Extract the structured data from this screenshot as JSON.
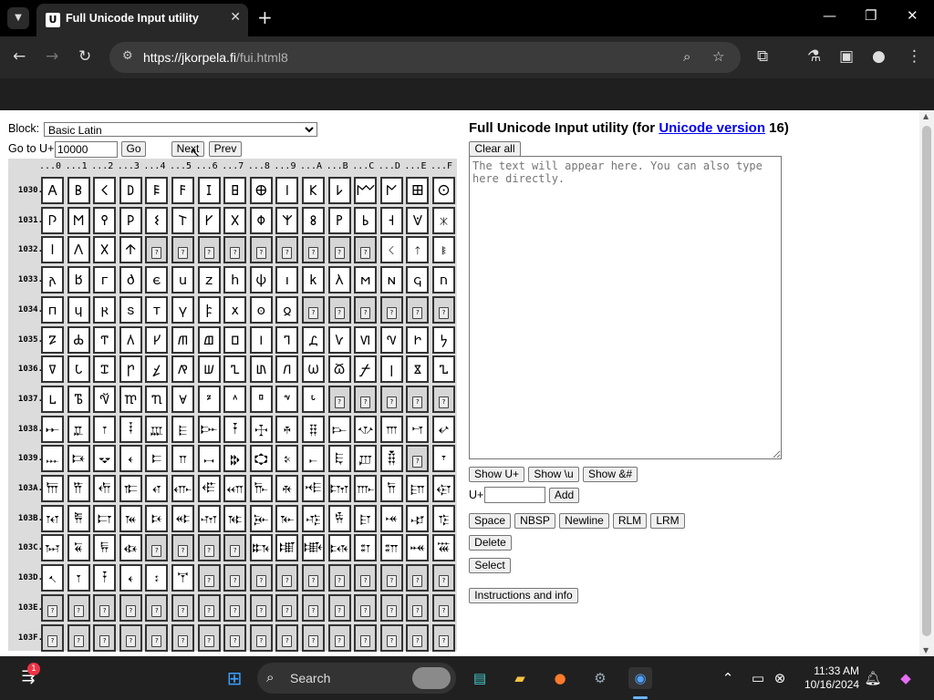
{
  "browser": {
    "tab_title": "Full Unicode Input utility",
    "favicon_letter": "U",
    "url_host": "https://jkorpela.fi",
    "url_path": "/fui.html8"
  },
  "page": {
    "block_label": "Block:",
    "block_selected": "Basic Latin",
    "goto_label": "Go to U+",
    "goto_value": "10000",
    "go_label": "Go",
    "next_label": "Next",
    "prev_label": "Prev",
    "title_prefix": "Full Unicode Input utility (for ",
    "title_link": "Unicode version",
    "title_suffix": " 16)",
    "clear_label": "Clear all",
    "textarea_placeholder": "The text will appear here. You can also type here directly.",
    "show_u_label": "Show U+",
    "show_backslash_u_label": "Show \\u",
    "show_entity_label": "Show &#",
    "uplus_label": "U+",
    "add_label": "Add",
    "space_label": "Space",
    "nbsp_label": "NBSP",
    "newline_label": "Newline",
    "rlm_label": "RLM",
    "lrm_label": "LRM",
    "delete_label": "Delete",
    "select_label": "Select",
    "instructions_label": "Instructions and info"
  },
  "grid": {
    "columns": [
      "...0",
      "...1",
      "...2",
      "...3",
      "...4",
      "...5",
      "...6",
      "...7",
      "...8",
      "...9",
      "...A",
      "...B",
      "...C",
      "...D",
      "...E",
      "...F"
    ],
    "rows": [
      {
        "label": "1030.",
        "cells": [
          "𐌀",
          "𐌁",
          "𐌂",
          "𐌃",
          "𐌄",
          "𐌅",
          "𐌆",
          "𐌇",
          "𐌈",
          "𐌉",
          "𐌊",
          "𐌋",
          "𐌌",
          "𐌍",
          "𐌎",
          "𐌏"
        ]
      },
      {
        "label": "1031.",
        "cells": [
          "𐌐",
          "𐌑",
          "𐌒",
          "𐌓",
          "𐌔",
          "𐌕",
          "𐌖",
          "𐌗",
          "𐌘",
          "𐌙",
          "𐌚",
          "𐌛",
          "𐌜",
          "𐌝",
          "𐌞",
          "𐌟"
        ]
      },
      {
        "label": "1032.",
        "cells": [
          "𐌠",
          "𐌡",
          "𐌢",
          "𐌣",
          "",
          "",
          "",
          "",
          "",
          "",
          "",
          "",
          "",
          "𐌭",
          "𐌮",
          "𐌯"
        ]
      },
      {
        "label": "1033.",
        "cells": [
          "𐌰",
          "𐌱",
          "𐌲",
          "𐌳",
          "𐌴",
          "𐌵",
          "𐌶",
          "𐌷",
          "𐌸",
          "𐌹",
          "𐌺",
          "𐌻",
          "𐌼",
          "𐌽",
          "𐌾",
          "𐌿"
        ]
      },
      {
        "label": "1034.",
        "cells": [
          "𐍀",
          "𐍁",
          "𐍂",
          "𐍃",
          "𐍄",
          "𐍅",
          "𐍆",
          "𐍇",
          "𐍈",
          "𐍉",
          "",
          "",
          "",
          "",
          "",
          ""
        ]
      },
      {
        "label": "1035.",
        "cells": [
          "𐍐",
          "𐍑",
          "𐍒",
          "𐍓",
          "𐍔",
          "𐍕",
          "𐍖",
          "𐍗",
          "𐍘",
          "𐍙",
          "𐍚",
          "𐍛",
          "𐍜",
          "𐍝",
          "𐍞",
          "𐍟"
        ]
      },
      {
        "label": "1036.",
        "cells": [
          "𐍠",
          "𐍡",
          "𐍢",
          "𐍣",
          "𐍤",
          "𐍥",
          "𐍦",
          "𐍧",
          "𐍨",
          "𐍩",
          "𐍪",
          "𐍫",
          "𐍬",
          "𐍭",
          "𐍮",
          "𐍯"
        ]
      },
      {
        "label": "1037.",
        "cells": [
          "𐍰",
          "𐍱",
          "𐍲",
          "𐍳",
          "𐍴",
          "𐍵",
          "𐍶",
          "𐍷",
          "𐍸",
          "𐍹",
          "𐍺",
          "",
          "",
          "",
          "",
          ""
        ]
      },
      {
        "label": "1038.",
        "cells": [
          "𐎀",
          "𐎁",
          "𐎂",
          "𐎃",
          "𐎄",
          "𐎅",
          "𐎆",
          "𐎇",
          "𐎈",
          "𐎉",
          "𐎊",
          "𐎋",
          "𐎌",
          "𐎍",
          "𐎎",
          "𐎏"
        ]
      },
      {
        "label": "1039.",
        "cells": [
          "𐎐",
          "𐎑",
          "𐎒",
          "𐎓",
          "𐎔",
          "𐎕",
          "𐎖",
          "𐎗",
          "𐎘",
          "𐎙",
          "𐎚",
          "𐎛",
          "𐎜",
          "𐎝",
          "",
          "𐎟"
        ]
      },
      {
        "label": "103A.",
        "cells": [
          "𐎠",
          "𐎡",
          "𐎢",
          "𐎣",
          "𐎤",
          "𐎥",
          "𐎦",
          "𐎧",
          "𐎨",
          "𐎩",
          "𐎪",
          "𐎫",
          "𐎬",
          "𐎭",
          "𐎮",
          "𐎯"
        ]
      },
      {
        "label": "103B.",
        "cells": [
          "𐎰",
          "𐎱",
          "𐎲",
          "𐎳",
          "𐎴",
          "𐎵",
          "𐎶",
          "𐎷",
          "𐎸",
          "𐎹",
          "𐎺",
          "𐎻",
          "𐎼",
          "𐎽",
          "𐎾",
          "𐎿"
        ]
      },
      {
        "label": "103C.",
        "cells": [
          "𐏀",
          "𐏁",
          "𐏂",
          "𐏃",
          "",
          "",
          "",
          "",
          "𐏈",
          "𐏉",
          "𐏊",
          "𐏋",
          "𐏌",
          "𐏍",
          "𐏎",
          "𐏏"
        ]
      },
      {
        "label": "103D.",
        "cells": [
          "𐏐",
          "𐏑",
          "𐏒",
          "𐏓",
          "𐏔",
          "𐏕",
          "",
          "",
          "",
          "",
          "",
          "",
          "",
          "",
          "",
          ""
        ]
      },
      {
        "label": "103E.",
        "cells": [
          "",
          "",
          "",
          "",
          "",
          "",
          "",
          "",
          "",
          "",
          "",
          "",
          "",
          "",
          "",
          ""
        ]
      },
      {
        "label": "103F.",
        "cells": [
          "",
          "",
          "",
          "",
          "",
          "",
          "",
          "",
          "",
          "",
          "",
          "",
          "",
          "",
          "",
          ""
        ]
      }
    ],
    "missing_glyph": "?"
  },
  "taskbar": {
    "search_label": "Search",
    "time": "11:33 AM",
    "date": "10/16/2024",
    "notification_count": "1"
  }
}
